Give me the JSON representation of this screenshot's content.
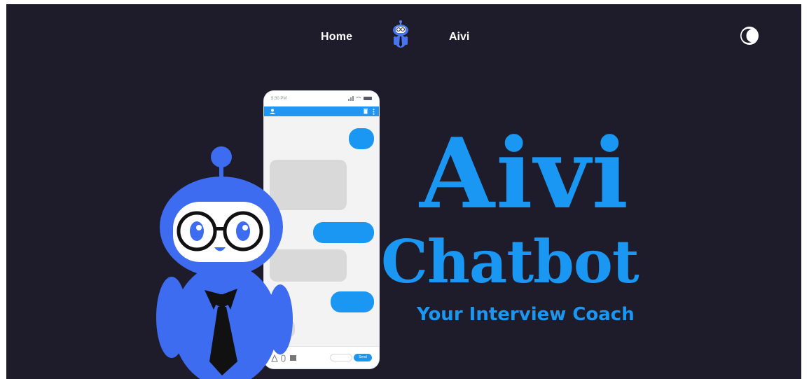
{
  "nav": {
    "home_label": "Home",
    "brand_label": "Aivi",
    "logo_icon": "robot-logo-icon",
    "theme_icon": "moon-icon"
  },
  "hero": {
    "title": "Aivi",
    "subtitle": "Chatbot",
    "tagline": "Your Interview Coach"
  },
  "phone": {
    "status_time": "5:30 PM",
    "input_placeholder": "",
    "send_label": "Send"
  },
  "colors": {
    "background": "#1e1c2a",
    "accent": "#1a97f2",
    "robot_blue": "#3d6cf0",
    "text_white": "#ffffff"
  }
}
